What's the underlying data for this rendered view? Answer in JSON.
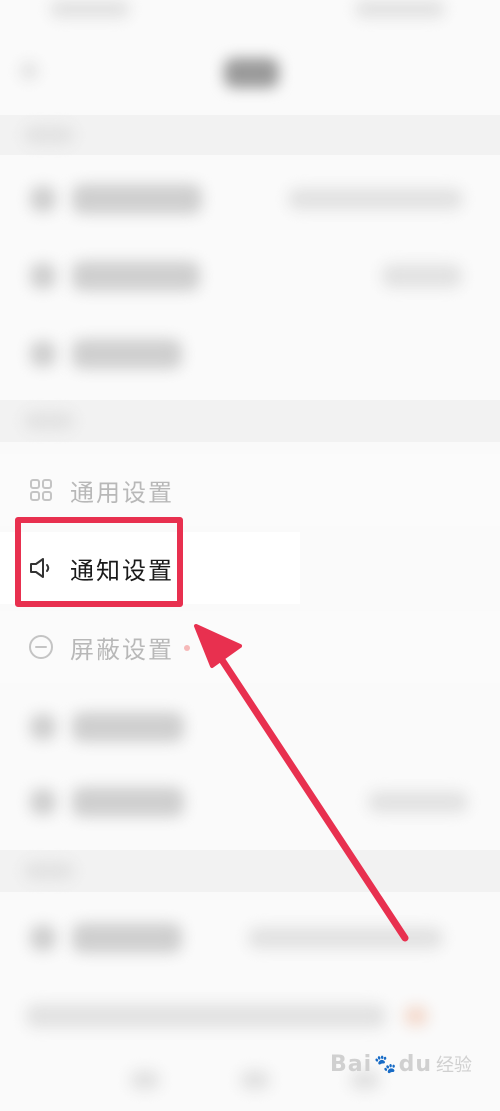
{
  "settings": {
    "items": [
      {
        "label": "通用设置",
        "icon": "grid-icon",
        "state": "faded"
      },
      {
        "label": "通知设置",
        "icon": "speaker-icon",
        "state": "active"
      },
      {
        "label": "屏蔽设置",
        "icon": "block-circle-icon",
        "state": "faded",
        "badge": "red-dot"
      }
    ]
  },
  "annotation": {
    "box_color": "#e8304f",
    "arrow_color": "#e8304f"
  },
  "watermark": {
    "brand": "Bai",
    "brand_tail": "du",
    "sub": "经验"
  },
  "colors": {
    "background": "#fafafa",
    "text_active": "#1a1a1a",
    "text_faded": "#b8b8b8",
    "accent": "#e8304f"
  }
}
